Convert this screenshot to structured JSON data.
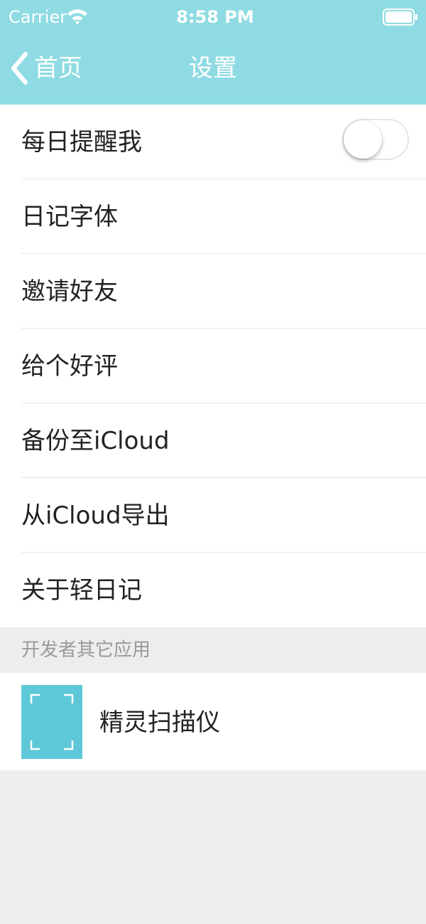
{
  "status_bar": {
    "carrier": "Carrier",
    "time": "8:58 PM"
  },
  "nav": {
    "back_label": "首页",
    "title": "设置"
  },
  "settings": {
    "items": [
      {
        "label": "每日提醒我",
        "has_toggle": true,
        "toggle_on": false
      },
      {
        "label": "日记字体"
      },
      {
        "label": "邀请好友"
      },
      {
        "label": "给个好评"
      },
      {
        "label": "备份至iCloud"
      },
      {
        "label": "从iCloud导出"
      },
      {
        "label": "关于轻日记"
      }
    ]
  },
  "other_apps": {
    "section_title": "开发者其它应用",
    "items": [
      {
        "name": "精灵扫描仪",
        "icon": "scanner-app-icon"
      }
    ]
  },
  "colors": {
    "header_bg": "#8fdbe3",
    "app_icon_bg": "#5ec8d8",
    "page_bg": "#efefef"
  }
}
